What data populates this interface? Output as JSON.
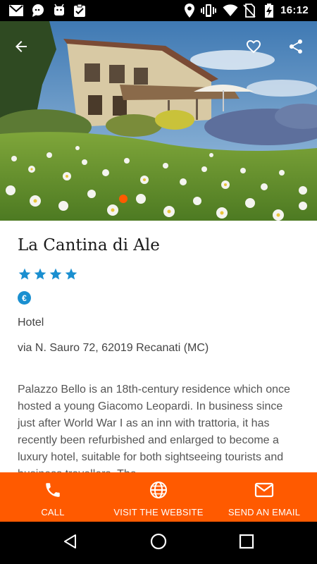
{
  "status_bar": {
    "time": "16:12",
    "icons": [
      "gmail-icon",
      "chat-icon",
      "android-icon",
      "clipboard-icon",
      "location-icon",
      "vibrate-icon",
      "wifi-icon",
      "no-sim-icon",
      "battery-charging-icon"
    ]
  },
  "hero": {
    "back_icon": "arrow-back-icon",
    "favorite_icon": "heart-outline-icon",
    "share_icon": "share-icon",
    "pager_dot_color": "#ff5a00"
  },
  "hotel": {
    "name": "La Cantina di Ale",
    "star_rating": 4,
    "star_color": "#1a8fd0",
    "price_symbol": "€",
    "price_color": "#1a8fd0",
    "type": "Hotel",
    "address": "via N. Sauro 72, 62019 Recanati (MC)",
    "description": "Palazzo Bello is an 18th-century residence which once hosted a young Giacomo Leopardi. In business since just after World War I as an inn with trattoria, it has recently been refurbished and enlarged to become a luxury hotel, suitable for both sightseeing tourists and business travellers. The"
  },
  "actions": {
    "bar_color": "#ff5a00",
    "call": {
      "label": "CALL",
      "icon": "phone-icon"
    },
    "website": {
      "label": "VISIT THE WEBSITE",
      "icon": "globe-icon"
    },
    "email": {
      "label": "SEND AN EMAIL",
      "icon": "mail-icon"
    }
  },
  "nav_bar": {
    "back_icon": "nav-back-icon",
    "home_icon": "nav-home-icon",
    "recents_icon": "nav-recents-icon"
  }
}
